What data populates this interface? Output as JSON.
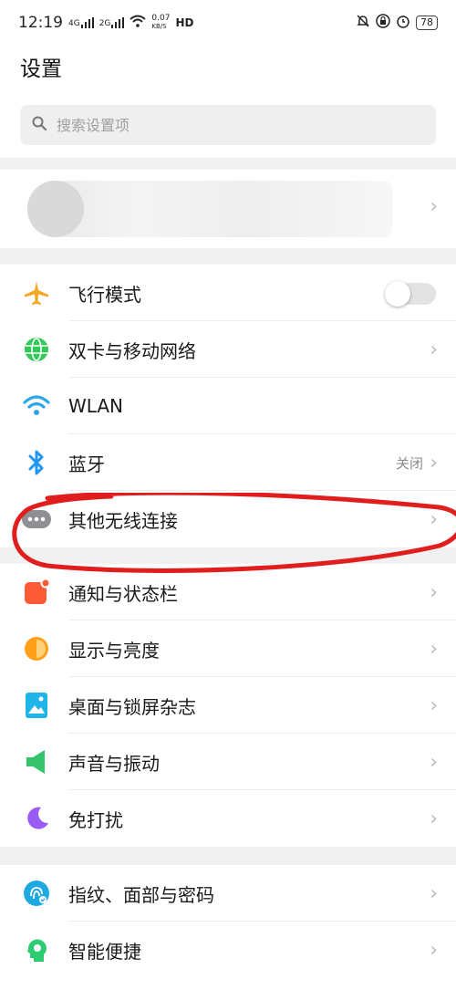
{
  "status_bar": {
    "time": "12:19",
    "network_speed": "0.07",
    "network_speed_unit": "KB/S",
    "signal1": "4G",
    "signal2": "2G",
    "hd": "HD",
    "battery": "78"
  },
  "header": {
    "title": "设置"
  },
  "search": {
    "placeholder": "搜索设置项"
  },
  "groups": [
    {
      "rows": [
        {
          "label": "飞行模式",
          "icon": "airplane-icon",
          "control": "toggle",
          "toggle_on": false
        },
        {
          "label": "双卡与移动网络",
          "icon": "globe-icon",
          "control": "chevron"
        },
        {
          "label": "WLAN",
          "icon": "wifi-icon",
          "control": "none"
        },
        {
          "label": "蓝牙",
          "icon": "bluetooth-icon",
          "control": "chevron",
          "value": "关闭"
        },
        {
          "label": "其他无线连接",
          "icon": "more-dots-icon",
          "control": "chevron"
        }
      ]
    },
    {
      "rows": [
        {
          "label": "通知与状态栏",
          "icon": "notification-icon",
          "control": "chevron"
        },
        {
          "label": "显示与亮度",
          "icon": "brightness-icon",
          "control": "chevron"
        },
        {
          "label": "桌面与锁屏杂志",
          "icon": "wallpaper-icon",
          "control": "chevron"
        },
        {
          "label": "声音与振动",
          "icon": "speaker-icon",
          "control": "chevron"
        },
        {
          "label": "免打扰",
          "icon": "moon-icon",
          "control": "chevron"
        }
      ]
    },
    {
      "rows": [
        {
          "label": "指纹、面部与密码",
          "icon": "fingerprint-icon",
          "control": "chevron"
        },
        {
          "label": "智能便捷",
          "icon": "smart-head-icon",
          "control": "chevron"
        }
      ]
    }
  ],
  "colors": {
    "airplane": "#f5a623",
    "globe": "#34c759",
    "wifi": "#2aa7e8",
    "bluetooth": "#2196f3",
    "more": "#8e8e93",
    "notification": "#ff5a36",
    "brightness": "#ff9f1a",
    "wallpaper": "#1fb5e8",
    "speaker": "#35c46b",
    "moon": "#9b5cf6",
    "fingerprint": "#1fa9e1",
    "smart": "#2ecc71",
    "annotation": "#e01e1e"
  }
}
